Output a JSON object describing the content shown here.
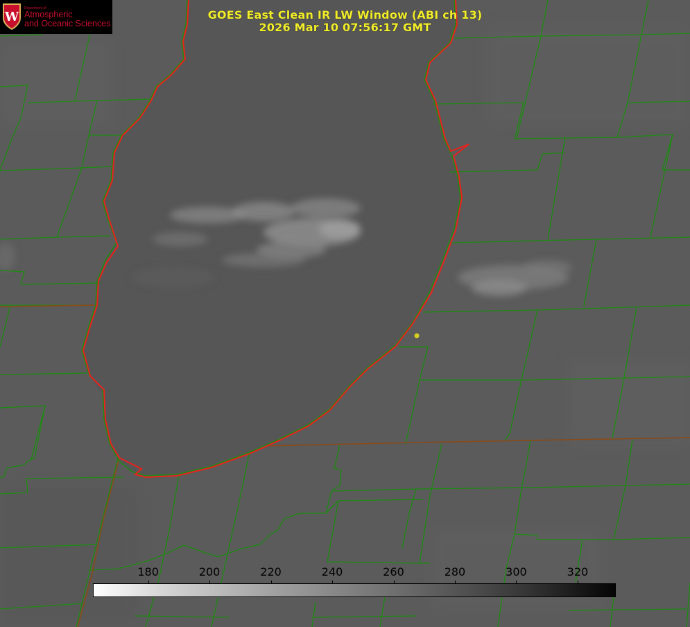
{
  "title": {
    "line1": "GOES East Clean IR LW Window (ABI ch 13)",
    "line2": "2026 Mar 10 07:56:17 GMT"
  },
  "logo": {
    "department": "Department of",
    "name_line1": "Atmospheric",
    "name_line2": "and Oceanic Sciences",
    "crest_letter": "W"
  },
  "colorbar": {
    "ticks": [
      "180",
      "200",
      "220",
      "240",
      "260",
      "280",
      "300",
      "320"
    ],
    "range": [
      162,
      332
    ],
    "gradient": "white-to-black"
  },
  "colors": {
    "lake_outline": "#e8231d",
    "county_lines": "#1e8c12",
    "title_text": "#f2ee2a",
    "marker": "#d8d020",
    "logo_red": "#c8102e"
  },
  "icons": [
    "uw-crest-icon",
    "location-marker-icon"
  ]
}
